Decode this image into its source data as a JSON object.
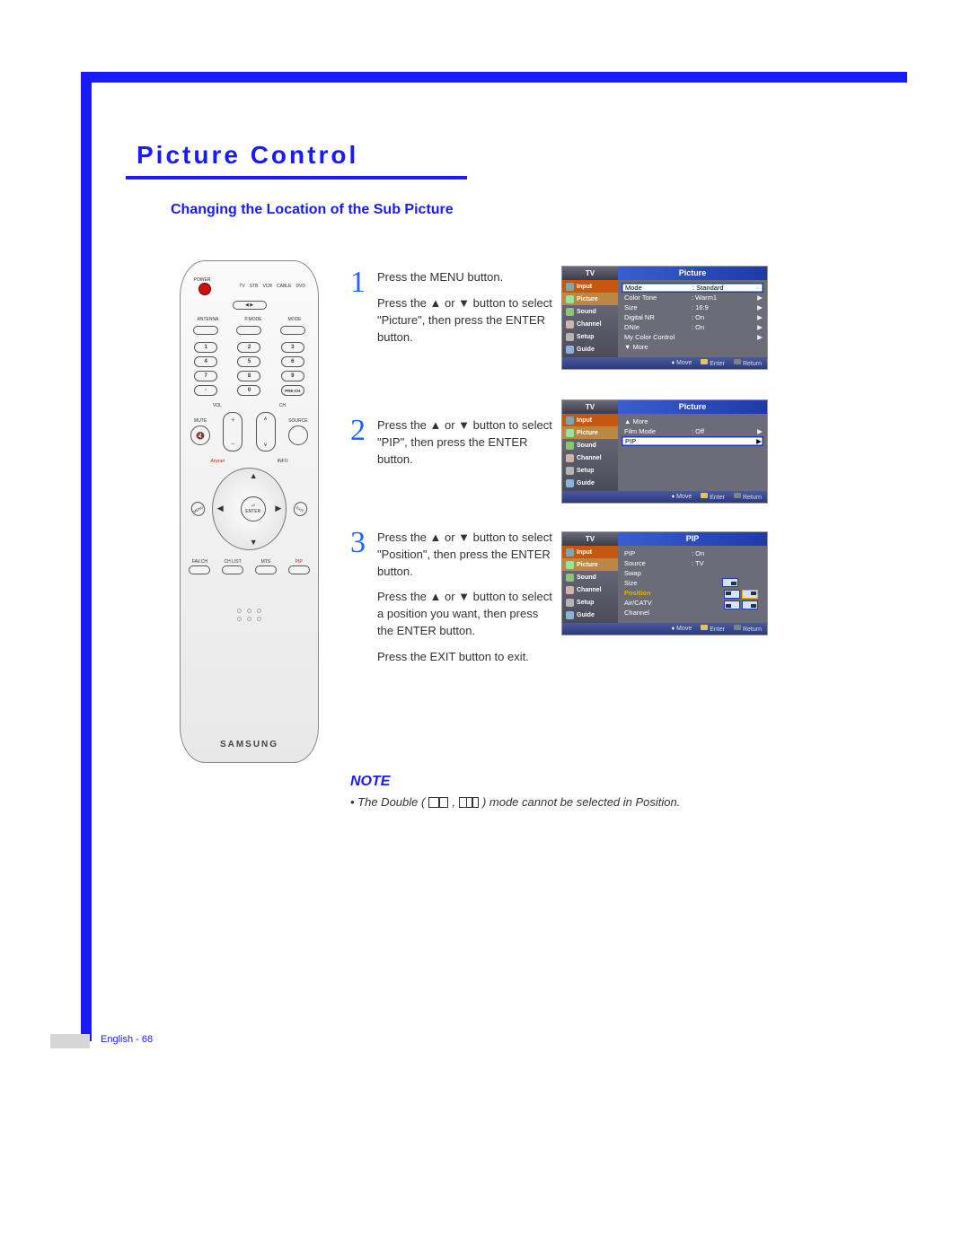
{
  "title": "Picture Control",
  "subtitle": "Changing the Location of the Sub Picture",
  "remote": {
    "power": "POWER",
    "srcrow": [
      "TV",
      "STB",
      "VCR",
      "CABLE",
      "DVD"
    ],
    "row2": [
      "ANTENNA",
      "P.MODE",
      "MODE"
    ],
    "numbers": [
      "1",
      "2",
      "3",
      "4",
      "5",
      "6",
      "7",
      "8",
      "9",
      "-",
      "0",
      "PRE-CH"
    ],
    "vol": "VOL",
    "ch": "CH",
    "mute": "MUTE",
    "source": "SOURCE",
    "anynet": "Anynet",
    "info": "INFO",
    "menu": "MENU",
    "exit": "EXIT",
    "enterLabel": "ENTER",
    "bottom": [
      "FAV.CH",
      "CH LIST",
      "MTS",
      "PIP"
    ],
    "brand": "SAMSUNG"
  },
  "steps": [
    {
      "n": "1",
      "lines": [
        "Press the MENU button.",
        "Press the ▲ or ▼ button to select \"Picture\", then press the ENTER button."
      ]
    },
    {
      "n": "2",
      "lines": [
        "Press the ▲ or ▼ button to select \"PIP\", then press the ENTER button."
      ]
    },
    {
      "n": "3",
      "lines": [
        "Press the ▲ or ▼ button to select \"Position\", then press the ENTER button.",
        "Press the ▲ or ▼ button to select a position you want, then press the ENTER button.",
        "Press the EXIT button to exit."
      ]
    }
  ],
  "osd_side_labels": [
    "Input",
    "Picture",
    "Sound",
    "Channel",
    "Setup",
    "Guide"
  ],
  "osd_footer": {
    "move": "Move",
    "enter": "Enter",
    "return": "Return"
  },
  "osd1": {
    "title_l": "TV",
    "title_r": "Picture",
    "rows": [
      {
        "k": "Mode",
        "v": ": Standard",
        "sel": true
      },
      {
        "k": "Color Tone",
        "v": ": Warm1"
      },
      {
        "k": "Size",
        "v": ": 16:9"
      },
      {
        "k": "Digital NR",
        "v": ": On"
      },
      {
        "k": "DNIe",
        "v": ": On"
      },
      {
        "k": "My Color Control",
        "v": ""
      },
      {
        "k": "▼ More",
        "v": ""
      }
    ]
  },
  "osd2": {
    "title_l": "TV",
    "title_r": "Picture",
    "rows": [
      {
        "k": "▲ More",
        "v": ""
      },
      {
        "k": "Film Mode",
        "v": ": Off"
      },
      {
        "k": "PIP",
        "v": "",
        "sel": true
      }
    ]
  },
  "osd3": {
    "title_l": "TV",
    "title_r": "PIP",
    "rows": [
      {
        "k": "PIP",
        "v": ": On"
      },
      {
        "k": "Source",
        "v": ": TV"
      },
      {
        "k": "Swap",
        "v": ""
      },
      {
        "k": "Size",
        "v": "",
        "icon": "size"
      },
      {
        "k": "Position",
        "v": "",
        "hl": true,
        "icon": "pos"
      },
      {
        "k": "Air/CATV",
        "v": ""
      },
      {
        "k": "Channel",
        "v": ""
      }
    ]
  },
  "note": {
    "heading": "NOTE",
    "pre": "• The Double (",
    "mid": " , ",
    "post": " ) mode cannot be selected in Position."
  },
  "footer": "English - 68"
}
